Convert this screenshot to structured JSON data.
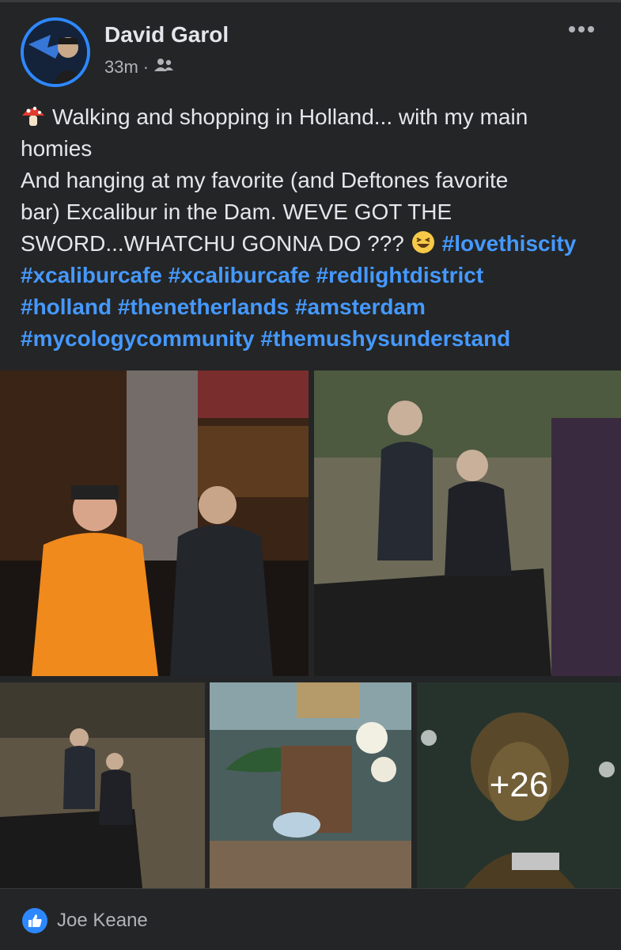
{
  "post": {
    "author": "David Garol",
    "timestamp": "33m",
    "separator": "·",
    "audience_icon": "friends-icon",
    "more_icon": "more-options-icon",
    "text_lines": [
      "Walking and shopping in Holland... with my main",
      "homies",
      "And hanging at my favorite (and Deftones favorite",
      "bar) Excalibur in the Dam. WEVE GOT THE",
      "SWORD...WHATCHU GONNA DO ???"
    ],
    "hashtags": [
      "#lovethiscity",
      "#xcaliburcafe",
      "#xcaliburcafe",
      "#redlightdistrict",
      "#holland",
      "#thenetherlands",
      "#amsterdam",
      "#mycologycommunity",
      "#themushysunderstand"
    ],
    "emojis": [
      "mushroom-icon",
      "laughing-face-icon"
    ]
  },
  "photos": {
    "more_count": "+26"
  },
  "reactions": {
    "icon": "like-icon",
    "liker": "Joe Keane"
  },
  "colors": {
    "background": "#242526",
    "text": "#e4e6eb",
    "secondary": "#b0b3b8",
    "hashtag": "#4599ff",
    "accent": "#2d88ff"
  }
}
